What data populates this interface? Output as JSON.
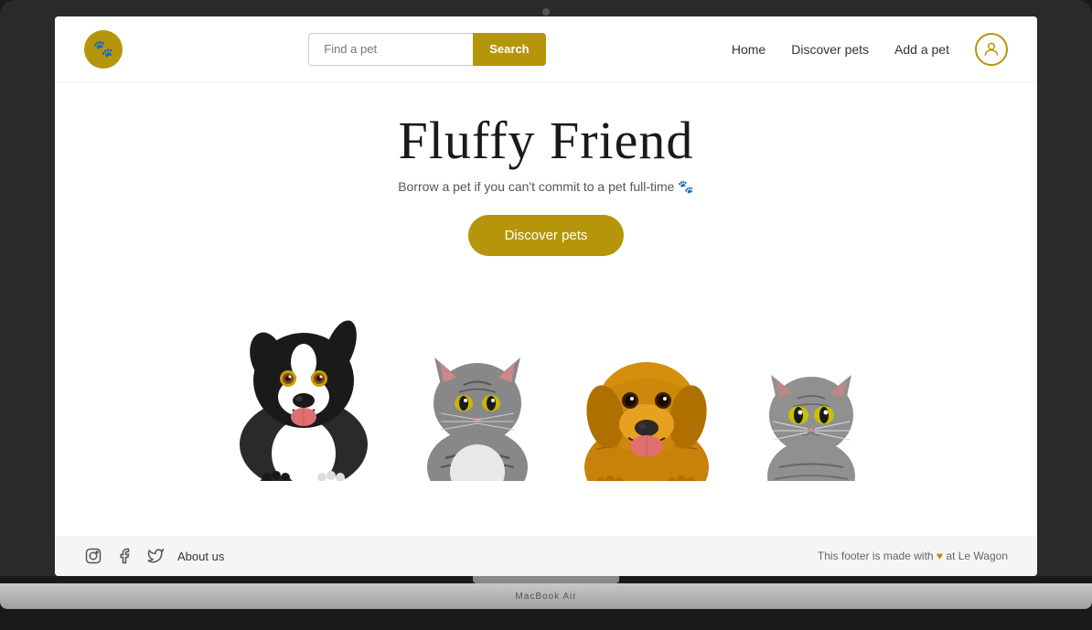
{
  "laptop": {
    "base_label": "MacBook Air"
  },
  "navbar": {
    "logo_emoji": "🐾",
    "search_placeholder": "Find a pet",
    "search_button_label": "Search",
    "links": [
      {
        "label": "Home",
        "name": "home-link"
      },
      {
        "label": "Discover pets",
        "name": "discover-pets-link"
      },
      {
        "label": "Add a pet",
        "name": "add-pet-link"
      }
    ]
  },
  "hero": {
    "title": "Fluffy Friend",
    "subtitle": "Borrow a pet if you can't commit to a pet full-time 🐾",
    "cta_label": "Discover pets"
  },
  "footer": {
    "about_label": "About us",
    "credit_text": "This footer is made with",
    "credit_suffix": "at Le Wagon",
    "heart": "♥"
  }
}
